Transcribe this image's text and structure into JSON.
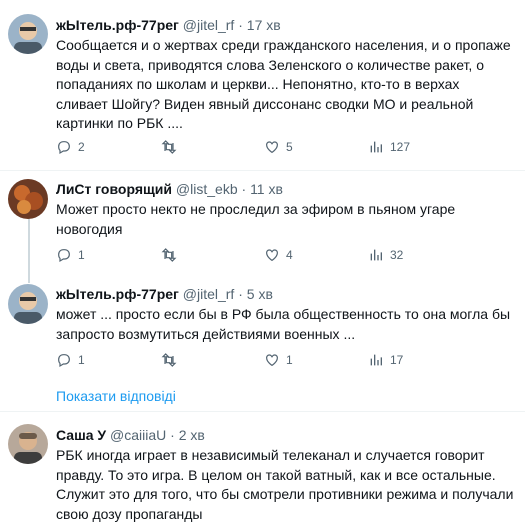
{
  "tweets": [
    {
      "author": "жЫтель.рф-77рег",
      "handle": "@jitel_rf",
      "dot": "·",
      "time": "17 хв",
      "text": "Сообщается и о жертвах среди гражданского населения, и о пропаже воды и света, приводятся слова Зеленского о количестве ракет, о попаданиях по школам и церкви... Непонятно, кто-то в верхах сливает Шойгу? Виден явный диссонанс сводки МО и реальной картинки по РБК ....",
      "replies": "2",
      "retweets": "",
      "likes": "5",
      "views": "127"
    },
    {
      "author": "ЛиСт говорящий",
      "handle": "@list_ekb",
      "dot": "·",
      "time": "11 хв",
      "text": "Может просто некто не проследил за эфиром в пьяном угаре новогодия",
      "replies": "1",
      "retweets": "",
      "likes": "4",
      "views": "32"
    },
    {
      "author": "жЫтель.рф-77рег",
      "handle": "@jitel_rf",
      "dot": "·",
      "time": "5 хв",
      "text": "может ... просто если бы в РФ была общественность то она могла бы запросто возмутиться действиями военных ...",
      "replies": "1",
      "retweets": "",
      "likes": "1",
      "views": "17"
    },
    {
      "author": "Саша У",
      "handle": "@caiiiaU",
      "dot": "·",
      "time": "2 хв",
      "text": "РБК иногда играет в независимый телеканал и случается говорит правду. То это игра. В целом он такой ватный, как и все остальные. Служит это для того, что бы смотрели противники режима и получали свою дозу пропаганды"
    }
  ],
  "show_replies": "Показати відповіді",
  "colors": {
    "accent": "#1d9bf0",
    "muted": "#536471",
    "text": "#0f1419",
    "divider": "#eff3f4"
  },
  "icons": [
    "reply-icon",
    "retweet-icon",
    "like-icon",
    "views-icon"
  ]
}
